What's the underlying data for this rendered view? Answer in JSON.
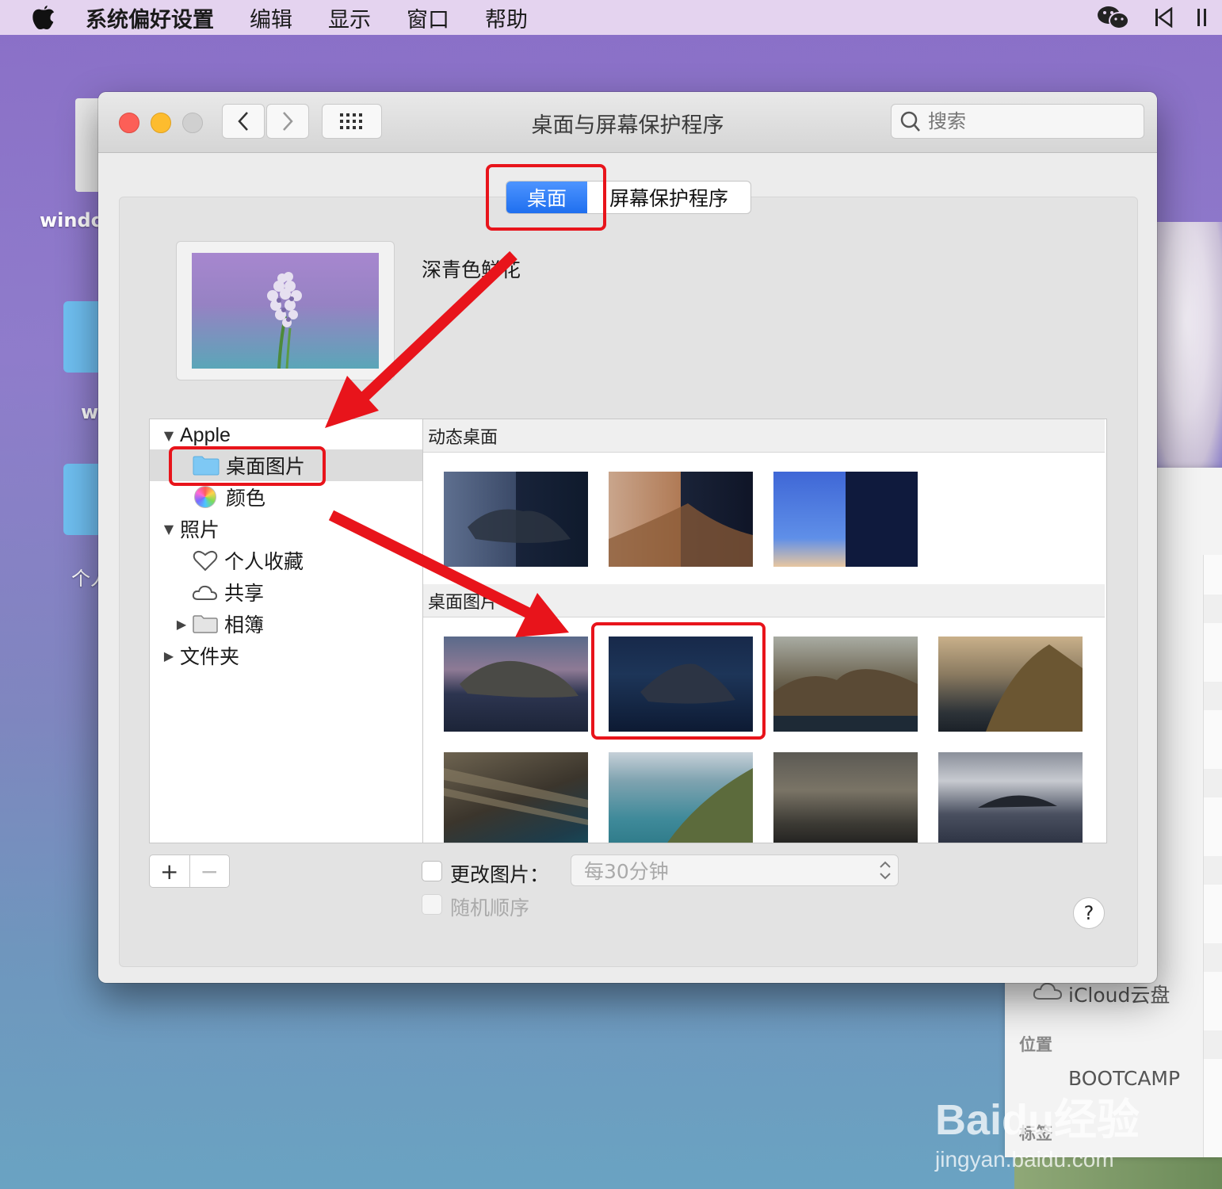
{
  "menubar": {
    "app_name": "系统偏好设置",
    "items": [
      "编辑",
      "显示",
      "窗口",
      "帮助"
    ]
  },
  "desktop": {
    "icon_labels": [
      "windo",
      "w",
      "个人"
    ]
  },
  "finder": {
    "icloud": "iCloud云盘",
    "locations_header": "位置",
    "bootcamp": "BOOTCAMP",
    "tags_header": "标签"
  },
  "window": {
    "title": "桌面与屏幕保护程序",
    "search_placeholder": "搜索",
    "tabs": {
      "desktop": "桌面",
      "screensaver": "屏幕保护程序"
    },
    "current_wallpaper": "深青色鲜花",
    "source_list": {
      "apple": "Apple",
      "desktop_pictures": "桌面图片",
      "colors": "颜色",
      "photos": "照片",
      "favorites": "个人收藏",
      "shared": "共享",
      "albums": "相簿",
      "folders": "文件夹"
    },
    "sections": {
      "dynamic": "动态桌面",
      "pictures": "桌面图片"
    },
    "plus_label": "+",
    "minus_label": "−",
    "change_picture_label": "更改图片：",
    "interval_value": "每30分钟",
    "random_order_label": "随机顺序",
    "help_label": "?"
  },
  "watermark": {
    "brand": "Baidu经验",
    "url": "jingyan.baidu.com"
  },
  "colors": {
    "accent": "#1f6fef",
    "annotation_red": "#e8141b"
  }
}
